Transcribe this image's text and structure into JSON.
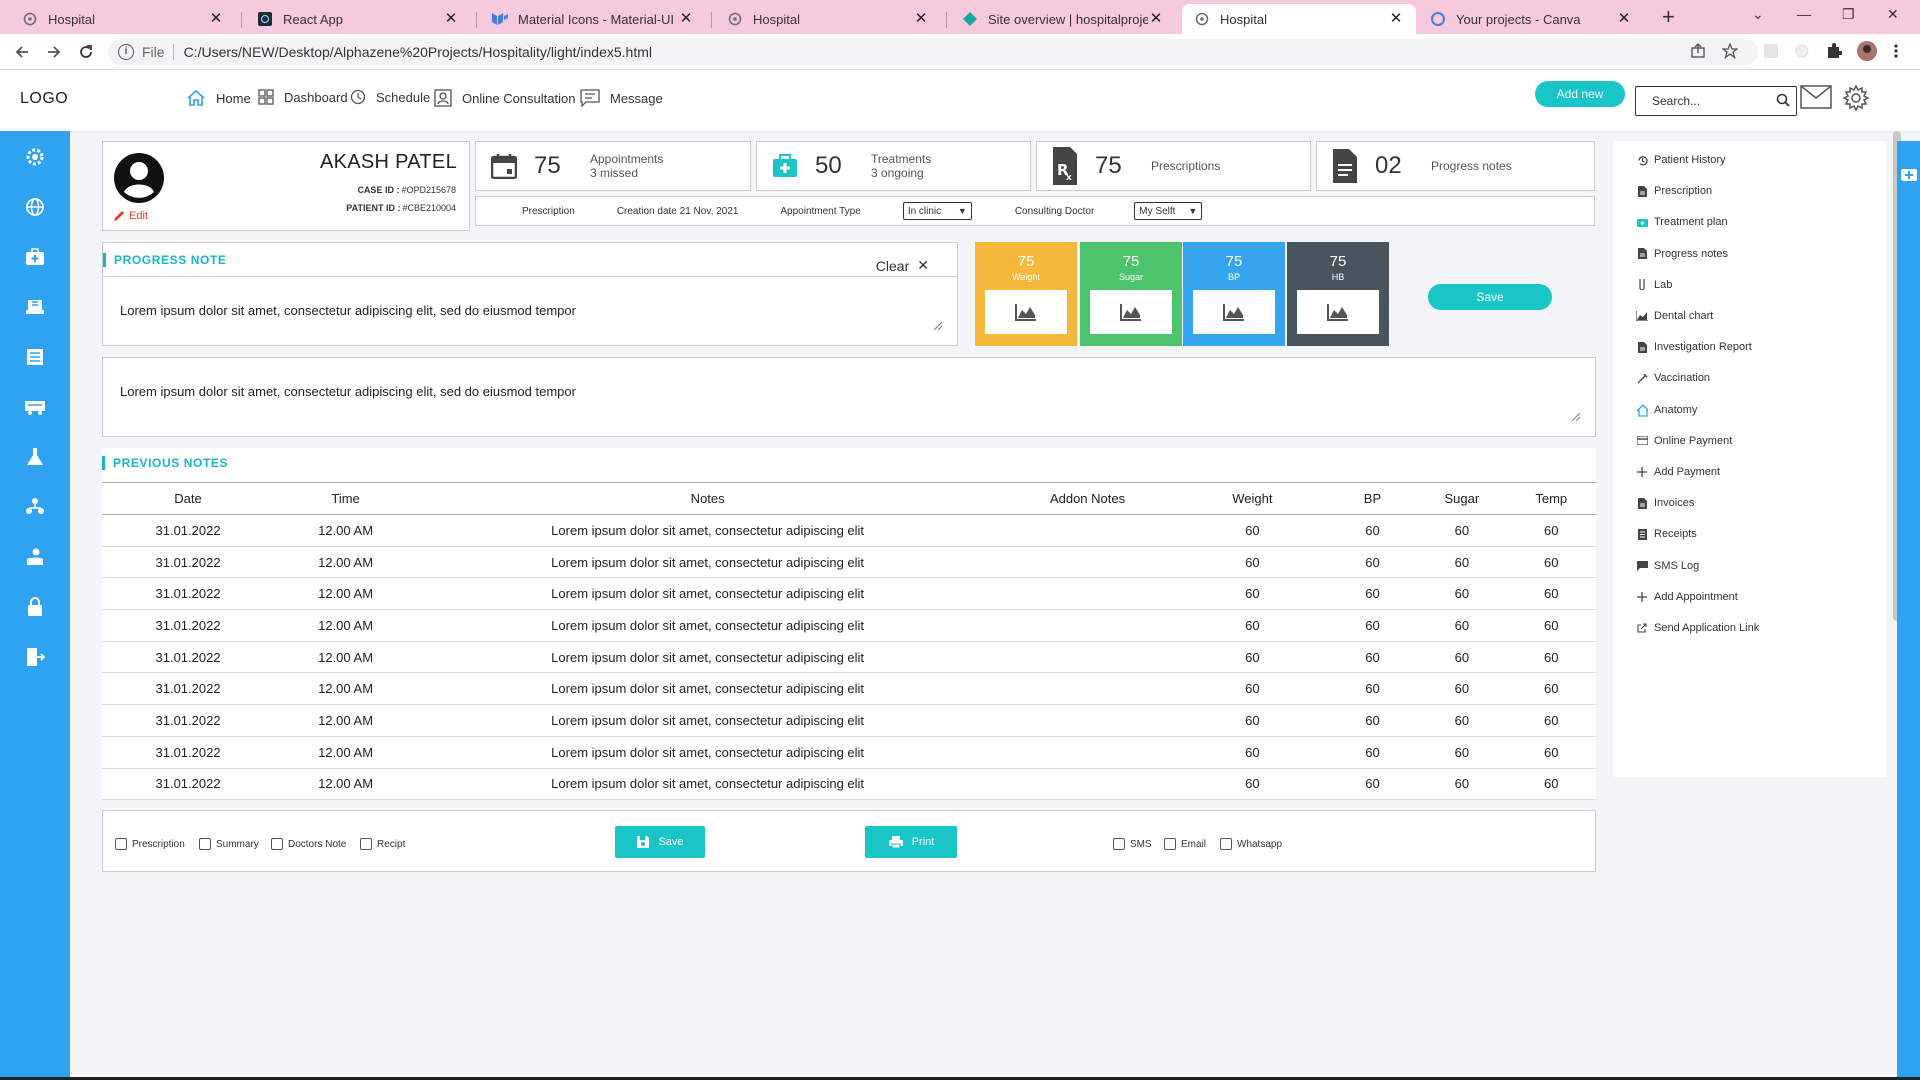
{
  "browser": {
    "tabs": [
      {
        "title": "Hospital",
        "icon": "react-icon"
      },
      {
        "title": "React App",
        "icon": "react-dark-icon"
      },
      {
        "title": "Material Icons - Material-UI",
        "icon": "mui-icon"
      },
      {
        "title": "Hospital",
        "icon": "react-icon"
      },
      {
        "title": "Site overview | hospitalprojectn",
        "icon": "netlify-icon"
      },
      {
        "title": "Hospital",
        "icon": "react-icon"
      },
      {
        "title": "Your projects - Canva",
        "icon": "canva-icon"
      }
    ],
    "active_tab": 5,
    "url_scheme": "File",
    "url": "C:/Users/NEW/Desktop/Alphazene%20Projects/Hospitality/light/index5.html"
  },
  "header": {
    "logo": "LOGO",
    "nav": [
      {
        "label": "Home",
        "icon": "home-icon"
      },
      {
        "label": "Dashboard",
        "icon": "dashboard-icon"
      },
      {
        "label": "Schedule",
        "icon": "schedule-icon"
      },
      {
        "label": "Online Consultation",
        "icon": "consultation-icon"
      },
      {
        "label": "Message",
        "icon": "message-icon"
      }
    ],
    "add_new": "Add new",
    "search_placeholder": "Search..."
  },
  "sidebar_icons": [
    "gear-icon",
    "globe-icon",
    "medical-kit-icon",
    "hospital-bed-icon",
    "ward-icon",
    "ambulance-icon",
    "lab-flask-icon",
    "staff-icon",
    "patient-care-icon",
    "lock-icon",
    "logout-icon"
  ],
  "patient": {
    "name": "AKASH PATEL",
    "case_id_label": "CASE ID :",
    "case_id": "#OPD215678",
    "patient_id_label": "PATIENT ID :",
    "patient_id": "#CBE210004",
    "edit": "Edit"
  },
  "stats": [
    {
      "icon": "calendar-icon",
      "value": "75",
      "label": "Appointments",
      "sub": "3 missed"
    },
    {
      "icon": "treatment-kit-icon",
      "value": "50",
      "label": "Treatments",
      "sub": "3 ongoing"
    },
    {
      "icon": "prescription-icon",
      "value": "75",
      "label": "Prescriptions",
      "sub": ""
    },
    {
      "icon": "document-icon",
      "value": "02",
      "label": "Progress notes",
      "sub": ""
    }
  ],
  "info_row": {
    "prescription": "Prescription",
    "creation_date": "Creation date 21 Nov, 2021",
    "appointment_type_label": "Appointment Type",
    "appointment_type_value": "In clinic",
    "consulting_doctor_label": "Consulting Doctor",
    "consulting_doctor_value": "My Selft"
  },
  "progress_note": {
    "title": "PROGRESS NOTE",
    "clear": "Clear",
    "text": "Lorem ipsum dolor sit amet, consectetur adipiscing elit, sed do eiusmod tempor",
    "text2": "Lorem ipsum dolor sit amet, consectetur adipiscing elit, sed do eiusmod tempor"
  },
  "vitals": [
    {
      "value": "75",
      "label": "Weight",
      "color": "#f5b83d"
    },
    {
      "value": "75",
      "label": "Sugar",
      "color": "#4cc46b"
    },
    {
      "value": "75",
      "label": "BP",
      "color": "#35a5f0"
    },
    {
      "value": "75",
      "label": "HB",
      "color": "#48555f"
    }
  ],
  "save_label": "Save",
  "previous_notes": {
    "title": "PREVIOUS NOTES",
    "columns": [
      "Date",
      "Time",
      "Notes",
      "Addon Notes",
      "Weight",
      "BP",
      "Sugar",
      "Temp"
    ],
    "rows": [
      [
        "31.01.2022",
        "12.00 AM",
        "Lorem ipsum dolor sit amet, consectetur adipiscing elit",
        "",
        "60",
        "60",
        "60",
        "60"
      ],
      [
        "31.01.2022",
        "12.00 AM",
        "Lorem ipsum dolor sit amet, consectetur adipiscing elit",
        "",
        "60",
        "60",
        "60",
        "60"
      ],
      [
        "31.01.2022",
        "12.00 AM",
        "Lorem ipsum dolor sit amet, consectetur adipiscing elit",
        "",
        "60",
        "60",
        "60",
        "60"
      ],
      [
        "31.01.2022",
        "12.00 AM",
        "Lorem ipsum dolor sit amet, consectetur adipiscing elit",
        "",
        "60",
        "60",
        "60",
        "60"
      ],
      [
        "31.01.2022",
        "12.00 AM",
        "Lorem ipsum dolor sit amet, consectetur adipiscing elit",
        "",
        "60",
        "60",
        "60",
        "60"
      ],
      [
        "31.01.2022",
        "12.00 AM",
        "Lorem ipsum dolor sit amet, consectetur adipiscing elit",
        "",
        "60",
        "60",
        "60",
        "60"
      ],
      [
        "31.01.2022",
        "12.00 AM",
        "Lorem ipsum dolor sit amet, consectetur adipiscing elit",
        "",
        "60",
        "60",
        "60",
        "60"
      ],
      [
        "31.01.2022",
        "12.00 AM",
        "Lorem ipsum dolor sit amet, consectetur adipiscing elit",
        "",
        "60",
        "60",
        "60",
        "60"
      ],
      [
        "31.01.2022",
        "12.00 AM",
        "Lorem ipsum dolor sit amet, consectetur adipiscing elit",
        "",
        "60",
        "60",
        "60",
        "60"
      ]
    ]
  },
  "footer": {
    "checks_left": [
      "Prescription",
      "Summary",
      "Doctors Note",
      "Recipt"
    ],
    "save": "Save",
    "print": "Print",
    "checks_right": [
      "SMS",
      "Email",
      "Whatsapp"
    ]
  },
  "right_menu": [
    {
      "label": "Patient History",
      "icon": "history-icon"
    },
    {
      "label": "Prescription",
      "icon": "file-icon"
    },
    {
      "label": "Treatment plan",
      "icon": "kit-icon"
    },
    {
      "label": "Progress notes",
      "icon": "file-icon"
    },
    {
      "label": "Lab",
      "icon": "test-tube-icon"
    },
    {
      "label": "Dental chart",
      "icon": "area-chart-icon"
    },
    {
      "label": "Investigation Report",
      "icon": "file-icon"
    },
    {
      "label": "Vaccination",
      "icon": "syringe-icon"
    },
    {
      "label": "Anatomy",
      "icon": "home-outline-icon"
    },
    {
      "label": "Online Payment",
      "icon": "card-icon"
    },
    {
      "label": "Add Payment",
      "icon": "plus-icon"
    },
    {
      "label": "Invoices",
      "icon": "file-icon"
    },
    {
      "label": "Receipts",
      "icon": "receipt-icon"
    },
    {
      "label": "SMS Log",
      "icon": "chat-icon"
    },
    {
      "label": "Add Appointment",
      "icon": "plus-icon"
    },
    {
      "label": "Send Application Link",
      "icon": "external-link-icon"
    }
  ],
  "colors": {
    "accent": "#19c5c6",
    "sidebar": "#2ea3f2",
    "tabbar": "#f7c9dd"
  }
}
